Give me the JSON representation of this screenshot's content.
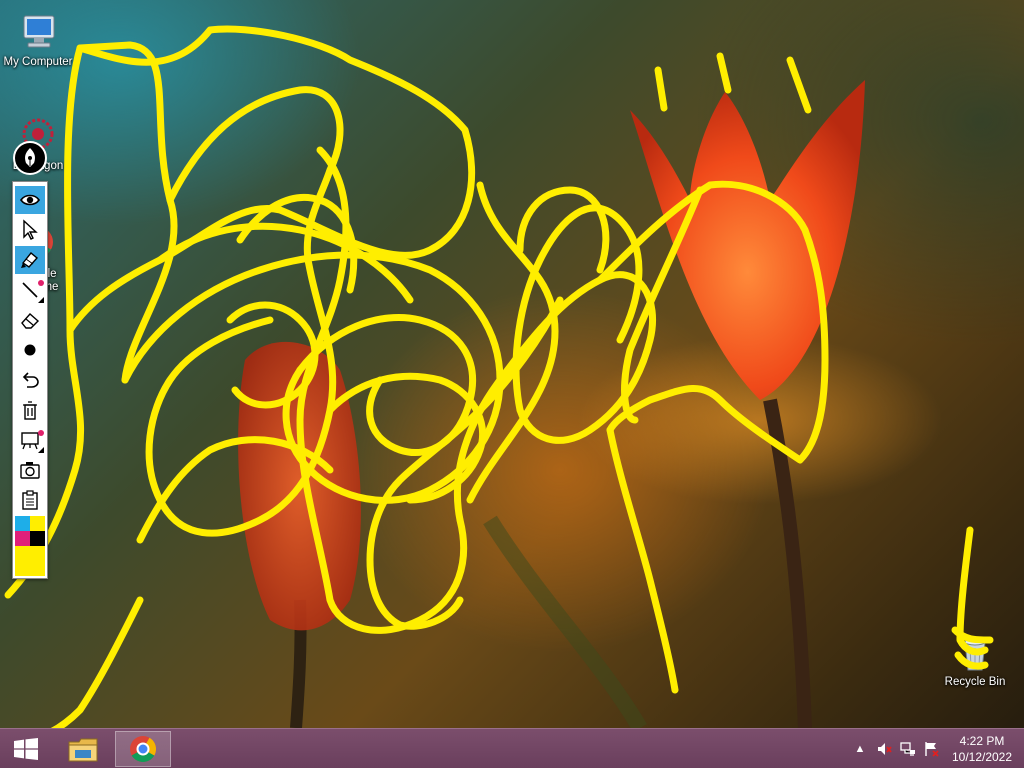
{
  "desktop": {
    "icons": [
      {
        "label": "My Computer",
        "icon": "computer-icon"
      },
      {
        "label": "Dadragon",
        "icon": "dadragon-icon"
      },
      {
        "label": "Google Chrome",
        "icon": "chrome-icon"
      },
      {
        "label": "Recycle Bin",
        "icon": "recycle-bin-icon"
      }
    ]
  },
  "draw_toolbar": {
    "tools": [
      {
        "name": "eye-icon"
      },
      {
        "name": "cursor-arrow-icon"
      },
      {
        "name": "highlighter-icon"
      },
      {
        "name": "line-icon"
      },
      {
        "name": "eraser-icon"
      },
      {
        "name": "brush-size-dot-icon"
      },
      {
        "name": "undo-icon"
      },
      {
        "name": "trash-icon"
      },
      {
        "name": "board-icon"
      },
      {
        "name": "camera-icon"
      },
      {
        "name": "clipboard-icon"
      }
    ],
    "active_tool": "highlighter-icon",
    "pen_color": "#ffee00",
    "palette": [
      "#1eaee8",
      "#ffee00",
      "#e0207a",
      "#000000",
      "#ffee00",
      "#ffee00"
    ]
  },
  "taskbar": {
    "start_icon": "windows-logo-icon",
    "pinned": [
      {
        "name": "file-explorer-icon",
        "active": false
      },
      {
        "name": "chrome-icon",
        "active": true
      }
    ],
    "tray": {
      "icons": [
        "show-hidden-icons-chevron-icon",
        "volume-muted-icon",
        "network-icon",
        "action-center-flag-icon"
      ],
      "time": "4:22 PM",
      "date": "10/12/2022"
    }
  }
}
